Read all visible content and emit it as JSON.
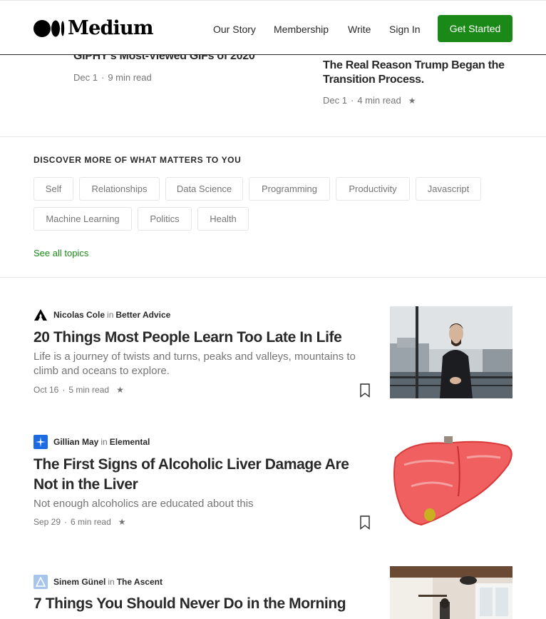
{
  "header": {
    "logo_text": "Medium",
    "nav": [
      "Our Story",
      "Membership",
      "Write",
      "Sign In"
    ],
    "cta": "Get Started"
  },
  "top_articles": [
    {
      "title": "GIPHY's Most-Viewed GIFs of 2020",
      "date": "Dec 1",
      "read_time": "9 min read"
    },
    {
      "title": "The Real Reason Trump Began the Transition Process.",
      "date": "Dec 1",
      "read_time": "4 min read",
      "starred": true
    }
  ],
  "discover": {
    "title": "DISCOVER MORE OF WHAT MATTERS TO YOU",
    "topics": [
      "Self",
      "Relationships",
      "Data Science",
      "Programming",
      "Productivity",
      "Javascript",
      "Machine Learning",
      "Politics",
      "Health"
    ],
    "see_all": "See all topics"
  },
  "articles": [
    {
      "author": "Nicolas Cole",
      "in": "in",
      "publication": "Better Advice",
      "title": "20 Things Most People Learn Too Late In Life",
      "subtitle": "Life is a journey of twists and turns, peaks and valleys, mountains to climb and oceans to explore.",
      "date": "Oct 16",
      "read_time": "5 min read",
      "starred": true
    },
    {
      "author": "Gillian May",
      "in": "in",
      "publication": "Elemental",
      "title": "The First Signs of Alcoholic Liver Damage Are Not in the Liver",
      "subtitle": "Not enough alcoholics are educated about this",
      "date": "Sep 29",
      "read_time": "6 min read",
      "starred": true
    },
    {
      "author": "Sinem Günel",
      "in": "in",
      "publication": "The Ascent",
      "title": "7 Things You Should Never Do in the Morning"
    }
  ],
  "colors": {
    "accent": "#1a8917",
    "text": "#292929",
    "muted": "#757575",
    "border": "#e6e6e6"
  }
}
